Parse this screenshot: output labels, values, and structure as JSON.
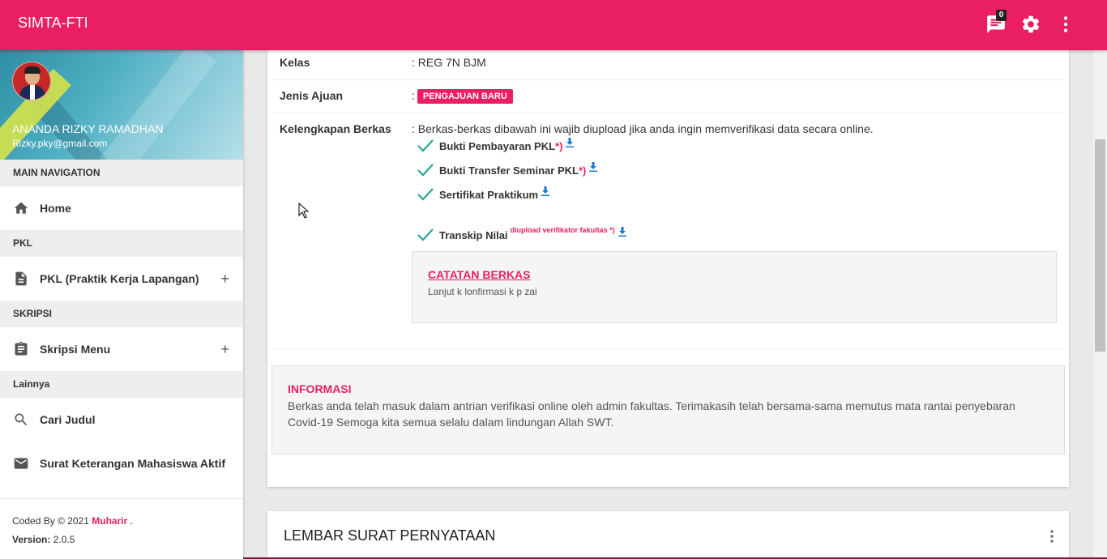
{
  "app": {
    "title": "SIMTA-FTI",
    "notification_count": "0"
  },
  "user": {
    "name": "ANANDA RIZKY RAMADHAN",
    "email": "Rizky.pky@gmail.com"
  },
  "sidebar": {
    "sections": [
      {
        "header": "MAIN NAVIGATION"
      },
      {
        "header": "PKL"
      },
      {
        "header": "SKRIPSI"
      },
      {
        "header": "Lainnya"
      }
    ],
    "items": [
      {
        "label": "Home",
        "icon": "home-icon"
      },
      {
        "label": "PKL (Praktik Kerja Lapangan)",
        "icon": "document-icon",
        "expand": "+"
      },
      {
        "label": "Skripsi Menu",
        "icon": "clipboard-icon",
        "expand": "+"
      },
      {
        "label": "Cari Judul",
        "icon": "search-icon"
      },
      {
        "label": "Surat Keterangan Mahasiswa Aktif",
        "icon": "mail-icon"
      }
    ],
    "footer": {
      "coded_by": "Coded By © 2021",
      "author": "Muharir",
      "dot": ".",
      "version_label": "Version:",
      "version": "2.0.5"
    }
  },
  "detail": {
    "kelas_label": "Kelas",
    "kelas_value": ": REG 7N BJM",
    "jenis_label": "Jenis Ajuan",
    "jenis_colon": ":",
    "jenis_badge": "PENGAJUAN BARU",
    "berkas_label": "Kelengkapan Berkas",
    "berkas_intro": ": Berkas-berkas dibawah ini wajib diupload jika anda ingin memverifikasi data secara online.",
    "files": [
      {
        "name": "Bukti Pembayaran PKL",
        "mark": "*)"
      },
      {
        "name": "Bukti Transfer Seminar PKL",
        "mark": "*)"
      },
      {
        "name": "Sertifikat Praktikum",
        "mark": ""
      },
      {
        "name": "Transkip Nilai",
        "note": "diupload verifikator fakultas *)"
      }
    ],
    "catatan_title": "CATATAN BERKAS",
    "catatan_body": "Lanjut k lonfirmasi k p zai",
    "info_title": "INFORMASI",
    "info_body": "Berkas anda telah masuk dalam antrian verifikasi online oleh admin fakultas. Terimakasih telah bersama-sama memutus mata rantai penyebaran Covid-19 Semoga kita semua selalu dalam lindungan Allah SWT."
  },
  "card2": {
    "title": "LEMBAR SURAT PERNYATAAN"
  },
  "colors": {
    "accent": "#e91e63",
    "check": "#26a69a",
    "download": "#1976d2"
  }
}
